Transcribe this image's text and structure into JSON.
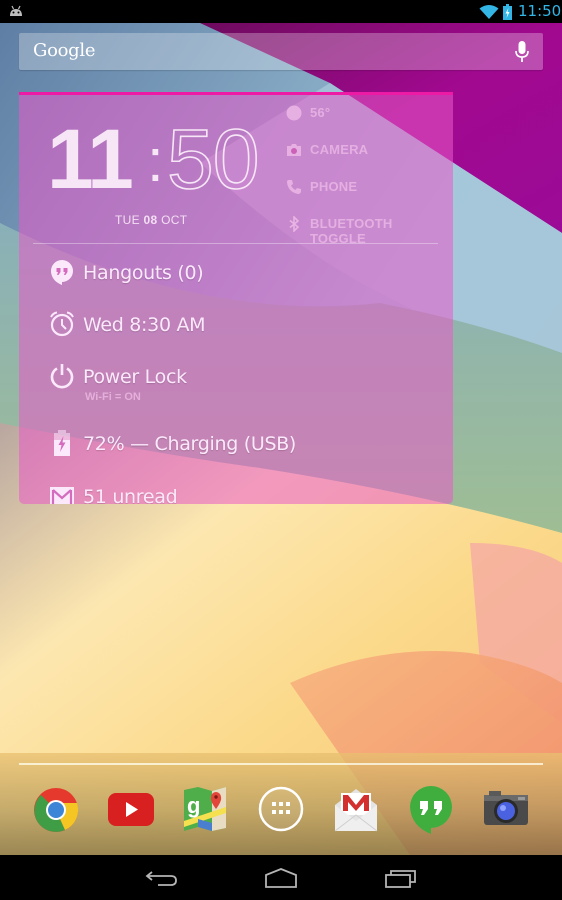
{
  "status_bar": {
    "time": "11:50",
    "icons": [
      "android-debug-icon",
      "wifi-icon",
      "battery-charging-icon"
    ],
    "accent_color": "#33b5e5"
  },
  "search": {
    "label": "Google",
    "voice_icon": "microphone-icon"
  },
  "widget": {
    "accent_color": "#ec1aa4",
    "clock": {
      "hours": "11",
      "separator": ":",
      "minutes": "50"
    },
    "date": {
      "day": "TUE",
      "date": "08",
      "month": "OCT"
    },
    "shortcuts": [
      {
        "icon": "weather-icon",
        "label": "56°"
      },
      {
        "icon": "camera-icon",
        "label": "CAMERA"
      },
      {
        "icon": "phone-icon",
        "label": "PHONE"
      },
      {
        "icon": "bluetooth-icon",
        "label": "BLUETOOTH TOGGLE"
      }
    ],
    "rows": [
      {
        "icon": "hangouts-icon",
        "label": "Hangouts (0)"
      },
      {
        "icon": "alarm-icon",
        "label": "Wed 8:30 AM"
      },
      {
        "icon": "power-icon",
        "label": "Power Lock",
        "sublabel": "Wi-Fi = ON"
      },
      {
        "icon": "battery-icon",
        "label": "72% — Charging (USB)"
      },
      {
        "icon": "gmail-icon",
        "label": "51 unread"
      }
    ]
  },
  "dock": {
    "apps": [
      {
        "name": "Chrome",
        "icon": "chrome-icon"
      },
      {
        "name": "YouTube",
        "icon": "youtube-icon"
      },
      {
        "name": "Maps",
        "icon": "maps-icon"
      },
      {
        "name": "All apps",
        "icon": "app-drawer-icon"
      },
      {
        "name": "Gmail",
        "icon": "gmail-icon"
      },
      {
        "name": "Hangouts",
        "icon": "hangouts-icon"
      },
      {
        "name": "Camera",
        "icon": "camera-icon"
      }
    ]
  },
  "nav_bar": {
    "buttons": [
      {
        "name": "Back",
        "icon": "back-icon"
      },
      {
        "name": "Home",
        "icon": "home-icon"
      },
      {
        "name": "Recent apps",
        "icon": "recents-icon"
      }
    ]
  }
}
